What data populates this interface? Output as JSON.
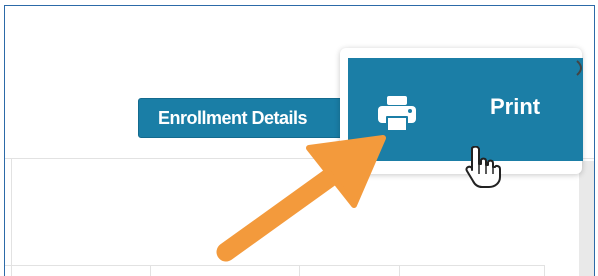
{
  "enrollment_button": {
    "label": "Enrollment Details"
  },
  "print_menu": {
    "print_label": "Print"
  },
  "icons": {
    "printer": "printer-icon",
    "cursor": "pointer-hand-icon",
    "annotation_arrow": "annotation-arrow"
  },
  "colors": {
    "accent": "#1b7ea6",
    "arrow": "#f39a3c",
    "frame_border": "#2c6aa8"
  }
}
